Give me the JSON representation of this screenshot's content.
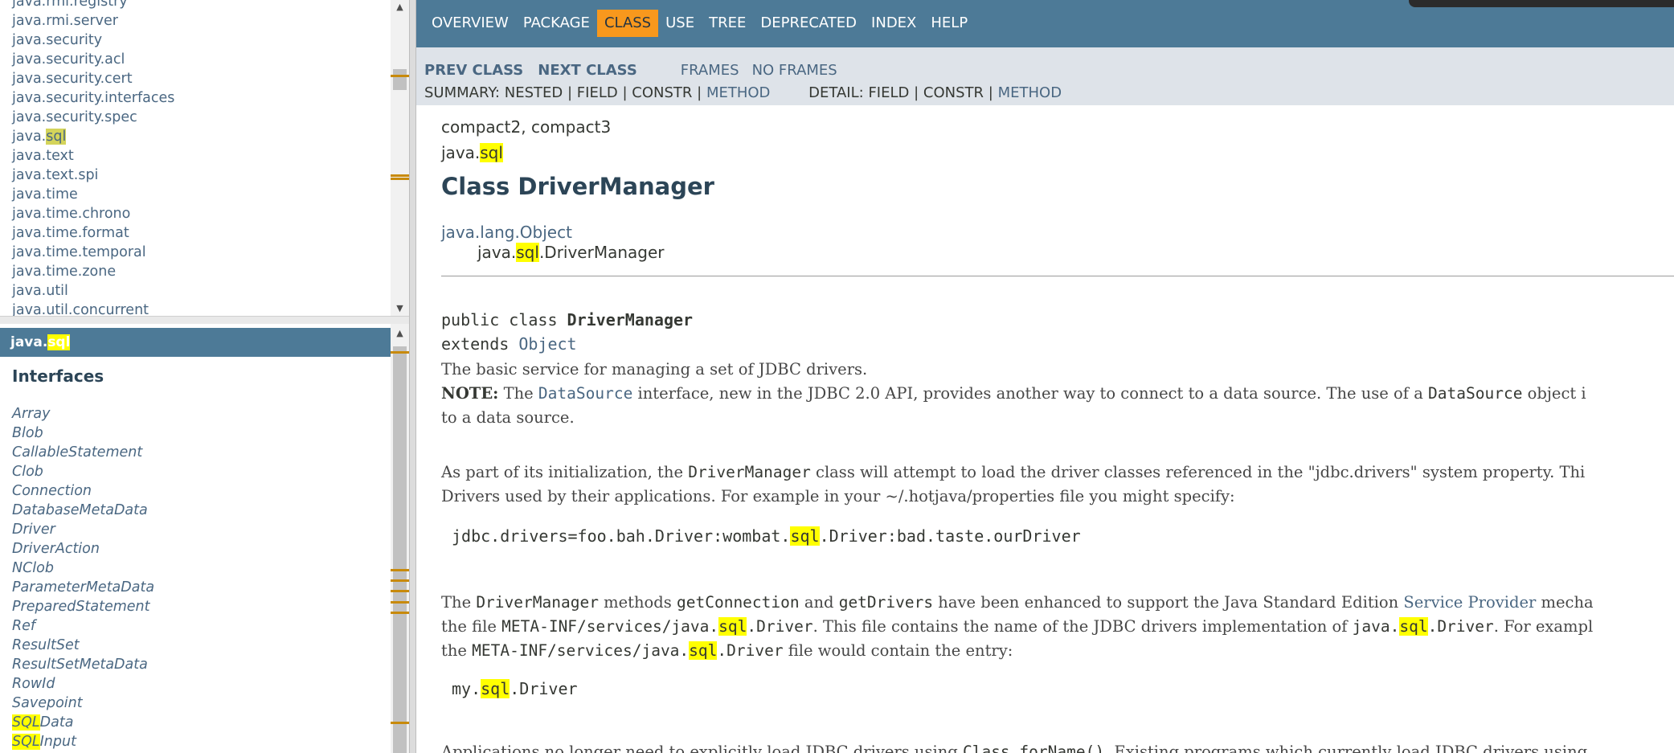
{
  "packages_frame": {
    "items": [
      {
        "pre": "java.rmi.registry",
        "hl": "",
        "post": ""
      },
      {
        "pre": "java.rmi.server",
        "hl": "",
        "post": ""
      },
      {
        "pre": "java.security",
        "hl": "",
        "post": ""
      },
      {
        "pre": "java.security.acl",
        "hl": "",
        "post": ""
      },
      {
        "pre": "java.security.cert",
        "hl": "",
        "post": ""
      },
      {
        "pre": "java.security.interfaces",
        "hl": "",
        "post": ""
      },
      {
        "pre": "java.security.spec",
        "hl": "",
        "post": ""
      },
      {
        "pre": "java.",
        "hl": "sql",
        "post": ""
      },
      {
        "pre": "java.text",
        "hl": "",
        "post": ""
      },
      {
        "pre": "java.text.spi",
        "hl": "",
        "post": ""
      },
      {
        "pre": "java.time",
        "hl": "",
        "post": ""
      },
      {
        "pre": "java.time.chrono",
        "hl": "",
        "post": ""
      },
      {
        "pre": "java.time.format",
        "hl": "",
        "post": ""
      },
      {
        "pre": "java.time.temporal",
        "hl": "",
        "post": ""
      },
      {
        "pre": "java.time.zone",
        "hl": "",
        "post": ""
      },
      {
        "pre": "java.util",
        "hl": "",
        "post": ""
      },
      {
        "pre": "java.util.concurrent",
        "hl": "",
        "post": ""
      }
    ]
  },
  "classes_frame": {
    "header": {
      "pre": "java.",
      "hl": "sql"
    },
    "interfaces_heading": "Interfaces",
    "interfaces": [
      {
        "hl": "",
        "post": "Array"
      },
      {
        "hl": "",
        "post": "Blob"
      },
      {
        "hl": "",
        "post": "CallableStatement"
      },
      {
        "hl": "",
        "post": "Clob"
      },
      {
        "hl": "",
        "post": "Connection"
      },
      {
        "hl": "",
        "post": "DatabaseMetaData"
      },
      {
        "hl": "",
        "post": "Driver"
      },
      {
        "hl": "",
        "post": "DriverAction"
      },
      {
        "hl": "",
        "post": "NClob"
      },
      {
        "hl": "",
        "post": "ParameterMetaData"
      },
      {
        "hl": "",
        "post": "PreparedStatement"
      },
      {
        "hl": "",
        "post": "Ref"
      },
      {
        "hl": "",
        "post": "ResultSet"
      },
      {
        "hl": "",
        "post": "ResultSetMetaData"
      },
      {
        "hl": "",
        "post": "RowId"
      },
      {
        "hl": "",
        "post": "Savepoint"
      },
      {
        "hl": "SQL",
        "post": "Data"
      },
      {
        "hl": "SQL",
        "post": "Input"
      }
    ]
  },
  "topnav": {
    "items": [
      "Overview",
      "Package",
      "Class",
      "Use",
      "Tree",
      "Deprecated",
      "Index",
      "Help"
    ],
    "active": "Class"
  },
  "subnav": {
    "prev_class": "PREV CLASS",
    "next_class": "NEXT CLASS",
    "frames": "FRAMES",
    "no_frames": "NO FRAMES",
    "summary_label": "SUMMARY:",
    "summary_nested": "NESTED",
    "summary_field": "FIELD",
    "summary_constr": "CONSTR",
    "summary_method": "METHOD",
    "detail_label": "DETAIL:",
    "detail_field": "FIELD",
    "detail_constr": "CONSTR",
    "detail_method": "METHOD",
    "sep": "|"
  },
  "main": {
    "profiles": "compact2, compact3",
    "package_pre": "java.",
    "package_hl": "sql",
    "class_title": "Class DriverManager",
    "inherit_root": "java.lang.Object",
    "inherit_child_pre": "java.",
    "inherit_child_hl": "sql",
    "inherit_child_post": ".DriverManager",
    "sig_kw": "public class ",
    "sig_name": "DriverManager",
    "sig_extends": "extends ",
    "sig_super": "Object",
    "p1_line1": "The basic service for managing a set of JDBC drivers.",
    "p1_note": "NOTE:",
    "p1_a": " The ",
    "p1_datasource": "DataSource",
    "p1_b": " interface, new in the JDBC 2.0 API, provides another way to connect to a data source. The use of a ",
    "p1_datasource2": "DataSource",
    "p1_c": " object i",
    "p1_line3": "to a data source.",
    "p2_a": "As part of its initialization, the ",
    "p2_code": "DriverManager",
    "p2_b": " class will attempt to load the driver classes referenced in the \"jdbc.drivers\" system property. Thi",
    "p2_line2": "Drivers used by their applications. For example in your ~/.hotjava/properties file you might specify:",
    "pre1_a": "jdbc.drivers=foo.bah.Driver:wombat.",
    "pre1_hl": "sql",
    "pre1_b": ".Driver:bad.taste.ourDriver",
    "p3_a": "The ",
    "p3_code1": "DriverManager",
    "p3_b": " methods ",
    "p3_code2": "getConnection",
    "p3_c": " and ",
    "p3_code3": "getDrivers",
    "p3_d": " have been enhanced to support the Java Standard Edition ",
    "p3_link": "Service Provider",
    "p3_e": " mecha",
    "p3_l2_a": "the file ",
    "p3_l2_code_a": "META-INF/services/java.",
    "p3_l2_hl": "sql",
    "p3_l2_code_b": ".Driver",
    "p3_l2_b": ". This file contains the name of the JDBC drivers implementation of ",
    "p3_l2_code2_a": "java.",
    "p3_l2_hl2": "sql",
    "p3_l2_code2_b": ".Driver",
    "p3_l2_c": ". For exampl",
    "p3_l3_a": "the ",
    "p3_l3_code_a": "META-INF/services/java.",
    "p3_l3_hl": "sql",
    "p3_l3_code_b": ".Driver",
    "p3_l3_b": " file would contain the entry:",
    "pre2_a": "my.",
    "pre2_hl": "sql",
    "pre2_b": ".Driver",
    "p4_a": "Applications no longer need to explicitly load JDBC drivers using ",
    "p4_code": "Class.forName()",
    "p4_b": ". Existing programs which currently load JDBC drivers using"
  }
}
